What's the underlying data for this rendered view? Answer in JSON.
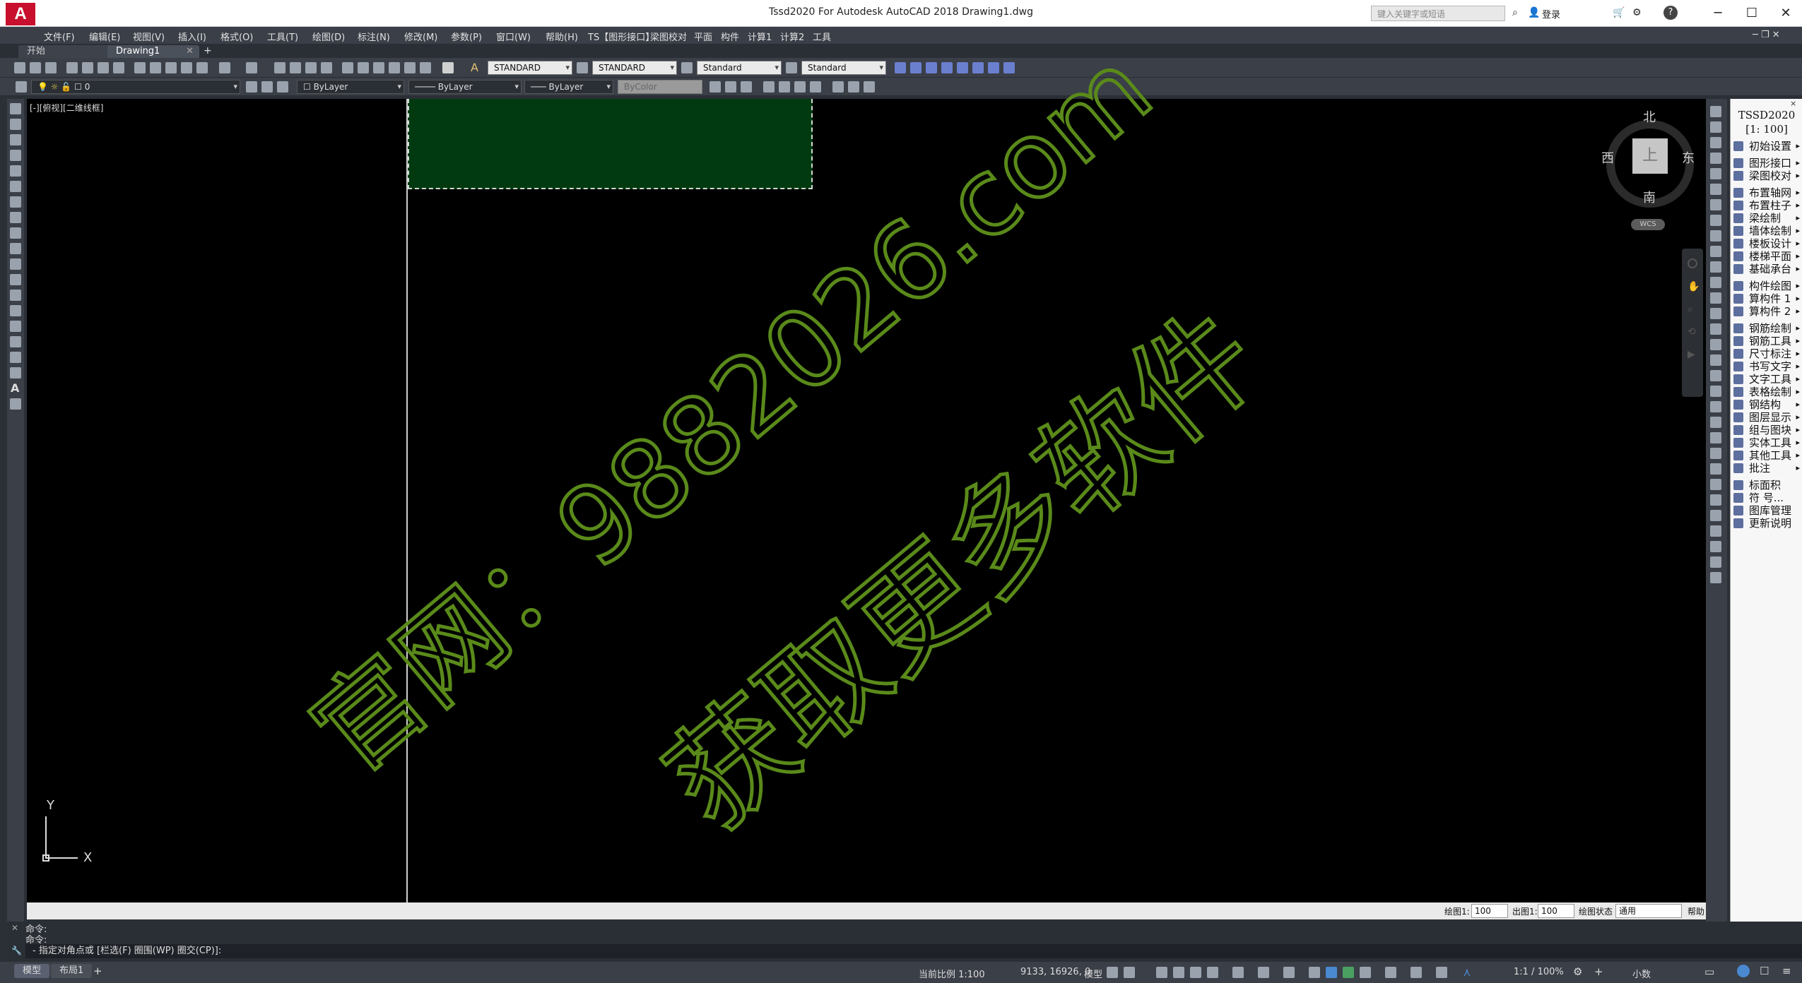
{
  "titlebar": {
    "app_title": "Tssd2020 For Autodesk AutoCAD 2018          Drawing1.dwg",
    "search_placeholder": "键入关键字或短语",
    "login": "登录",
    "help": "?"
  },
  "menu": [
    "文件(F)",
    "编辑(E)",
    "视图(V)",
    "插入(I)",
    "格式(O)",
    "工具(T)",
    "绘图(D)",
    "标注(N)",
    "修改(M)",
    "参数(P)",
    "窗口(W)",
    "帮助(H)",
    "TS【图形接口】",
    "梁图校对",
    "平面",
    "构件",
    "计算1",
    "计算2",
    "工具"
  ],
  "tabs": [
    {
      "label": "开始",
      "active": false
    },
    {
      "label": "Drawing1",
      "active": true
    }
  ],
  "toolbar": {
    "text_style": "STANDARD",
    "dim_style": "STANDARD",
    "table_style": "Standard",
    "mleader_style": "Standard",
    "layer": "0",
    "color": "ByLayer",
    "linetype": "ByLayer",
    "lineweight": "ByLayer",
    "plotstyle": "ByColor"
  },
  "viewport": {
    "label": "[-][俯视][二维线框]",
    "compass": {
      "north": "北",
      "south": "南",
      "east": "东",
      "west": "西",
      "top": "上"
    },
    "wcs": "WCS",
    "ucs_x": "X",
    "ucs_y": "Y"
  },
  "scale_bar": {
    "draw_label": "绘图1:",
    "draw_value": "100",
    "out_label": "出图1:",
    "out_value": "100",
    "state_label": "绘图状态",
    "state_value": "通用",
    "help": "帮助"
  },
  "command": {
    "line1": "命令:",
    "line2": "命令:",
    "prompt": "- 指定对角点或 [栏选(F) 圈围(WP) 圈交(CP)]:"
  },
  "statusbar": {
    "model_tab": "模型",
    "layout_tab": "布局1",
    "scale_text": "当前比例 1:100",
    "coords": "9133, 16926, 0",
    "model": "模型",
    "annotation_scale": "1:1 / 100%",
    "units": "小数"
  },
  "tssd_panel": {
    "title": "TSSD2020",
    "scale": "[1: 100]",
    "items": [
      "初始设置",
      "图形接口",
      "梁图校对",
      "布置轴网",
      "布置柱子",
      "梁绘制",
      "墙体绘制",
      "楼板设计",
      "楼梯平面",
      "基础承台",
      "构件绘图",
      "算构件 1",
      "算构件 2",
      "钢筋绘制",
      "钢筋工具",
      "尺寸标注",
      "书写文字",
      "文字工具",
      "表格绘制",
      "钢结构",
      "图层显示",
      "组与图块",
      "实体工具",
      "其他工具",
      "批注",
      "标面积",
      "符  号...",
      "图库管理",
      "更新说明"
    ]
  },
  "watermark": {
    "line1": "官网：9882026.com",
    "line2": "获取更多软件",
    "color": "#5a8a1a"
  }
}
